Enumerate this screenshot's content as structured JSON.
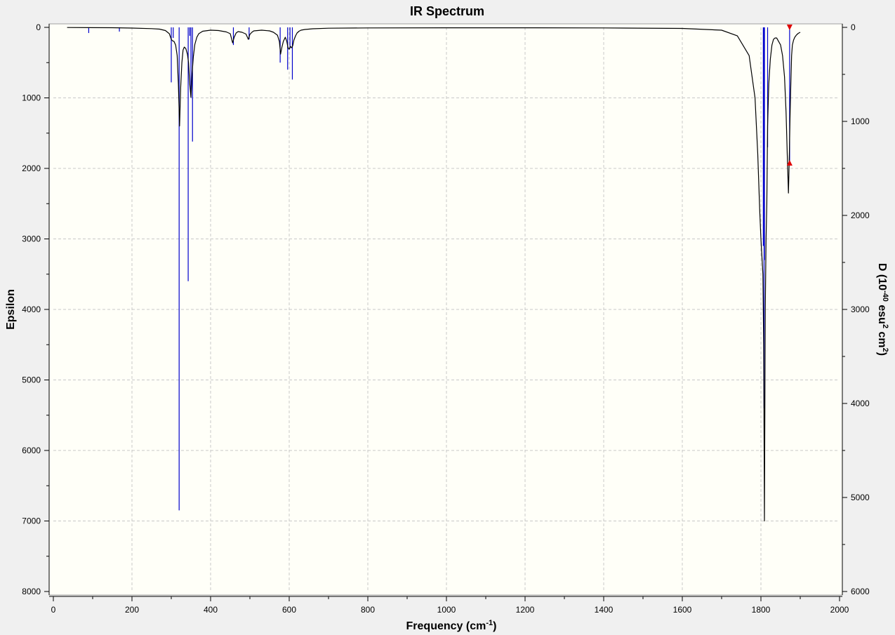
{
  "chart_data": {
    "type": "line",
    "title": "IR Spectrum",
    "xlabel": "Frequency (cm",
    "xlabel_sup": "-1",
    "xlabel_end": ")",
    "ylabel_left": "Epsilon",
    "ylabel_right": {
      "parts": [
        "D (10",
        "-40",
        " esu",
        "2",
        " cm",
        "2",
        ")"
      ]
    },
    "xlim": [
      0,
      2000
    ],
    "ylim_left": [
      0,
      8000
    ],
    "ylim_right": [
      0,
      6000
    ],
    "left_axis_inverted": true,
    "right_axis_inverted": true,
    "x_ticks": [
      "0",
      "200",
      "400",
      "600",
      "800",
      "1000",
      "1200",
      "1400",
      "1600",
      "1800",
      "2000"
    ],
    "y_left_ticks": [
      "0",
      "1000",
      "2000",
      "3000",
      "4000",
      "5000",
      "6000",
      "7000",
      "8000"
    ],
    "y_right_ticks": [
      "0",
      "1000",
      "2000",
      "3000",
      "4000",
      "5000",
      "6000"
    ],
    "grid": true,
    "colors": {
      "spectrum": "#000000",
      "sticks": "#0000cc",
      "marker": "#e00000",
      "plot_background": "#fffff8",
      "frame_background": "#f0f0f0"
    },
    "series": [
      {
        "role": "spectrum_line",
        "x": [
          35,
          150,
          200,
          250,
          270,
          285,
          295,
          300,
          303,
          307,
          311,
          315,
          318,
          321,
          324,
          327,
          330,
          333,
          337,
          341,
          344,
          347,
          350,
          353,
          356,
          360,
          365,
          370,
          380,
          400,
          420,
          440,
          450,
          456,
          460,
          465,
          470,
          480,
          490,
          496,
          500,
          505,
          510,
          530,
          550,
          560,
          570,
          575,
          578,
          581,
          585,
          590,
          594,
          597,
          600,
          603,
          606,
          609,
          612,
          616,
          620,
          625,
          630,
          640,
          660,
          700,
          800,
          1000,
          1200,
          1400,
          1600,
          1700,
          1740,
          1770,
          1785,
          1792,
          1797,
          1800,
          1803,
          1805,
          1807,
          1809,
          1811,
          1813,
          1815,
          1817,
          1820,
          1824,
          1828,
          1832,
          1836,
          1840,
          1845,
          1850,
          1855,
          1860,
          1864,
          1867,
          1870,
          1872,
          1874,
          1876,
          1878,
          1880,
          1883,
          1886,
          1890,
          1895,
          1900
        ],
        "y": [
          2,
          5,
          10,
          18,
          25,
          45,
          90,
          170,
          190,
          200,
          250,
          400,
          800,
          1400,
          850,
          500,
          320,
          280,
          300,
          380,
          500,
          800,
          990,
          650,
          420,
          240,
          140,
          90,
          55,
          40,
          45,
          65,
          90,
          220,
          140,
          80,
          60,
          70,
          95,
          170,
          100,
          70,
          50,
          40,
          50,
          70,
          110,
          200,
          380,
          290,
          200,
          140,
          200,
          290,
          310,
          270,
          290,
          260,
          180,
          120,
          80,
          55,
          40,
          30,
          20,
          12,
          8,
          6,
          6,
          8,
          15,
          40,
          120,
          400,
          1000,
          1800,
          2600,
          3000,
          3300,
          3500,
          4500,
          7000,
          4000,
          3000,
          2500,
          1400,
          800,
          450,
          250,
          170,
          150,
          150,
          200,
          250,
          400,
          700,
          1200,
          1800,
          2350,
          1900,
          1300,
          800,
          400,
          250,
          180,
          140,
          110,
          85,
          70
        ]
      },
      {
        "role": "stick_lines",
        "x": [
          90,
          168,
          300,
          305,
          320,
          343,
          347,
          350,
          354,
          458,
          498,
          577,
          596,
          602,
          608,
          1806,
          1808,
          1809,
          1817,
          1873
        ],
        "y": [
          80,
          60,
          780,
          150,
          6850,
          3600,
          120,
          1000,
          1620,
          250,
          170,
          500,
          600,
          300,
          740,
          3100,
          5400,
          3300,
          1700,
          1900
        ]
      }
    ],
    "markers": [
      {
        "shape": "triangle-down",
        "x": 1873,
        "y": 0
      },
      {
        "shape": "triangle-up",
        "x": 1873,
        "y": 1920
      }
    ]
  }
}
